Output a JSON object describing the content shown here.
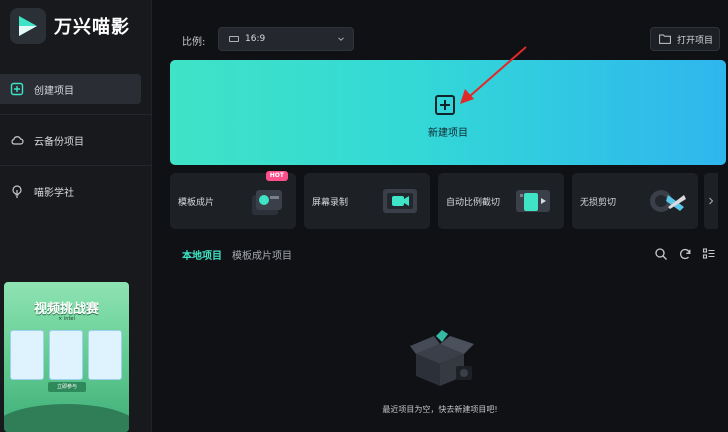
{
  "app": {
    "name": "万兴喵影"
  },
  "sidebar": {
    "items": [
      {
        "label": "创建项目",
        "icon": "add-square-icon",
        "active": true
      },
      {
        "label": "云备份项目",
        "icon": "cloud-icon",
        "active": false
      },
      {
        "label": "喵影学社",
        "icon": "bulb-icon",
        "active": false
      }
    ],
    "promo": {
      "title": "视频挑战赛",
      "subtitle": "× intel",
      "cta": "立即参与"
    }
  },
  "toolbar": {
    "ratio_label": "比例:",
    "ratio_value": "16:9",
    "open_label": "打开项目"
  },
  "hero": {
    "label": "新建项目"
  },
  "tools": [
    {
      "label": "模板成片",
      "badge": "HOT"
    },
    {
      "label": "屏幕录制"
    },
    {
      "label": "自动比例截切"
    },
    {
      "label": "无损剪切"
    }
  ],
  "tabs": [
    {
      "label": "本地项目",
      "active": true
    },
    {
      "label": "模板成片项目",
      "active": false
    }
  ],
  "empty": {
    "message": "最近项目为空，快去新建项目吧!"
  },
  "colors": {
    "accent": "#3fe3c6",
    "hero_start": "#3fe3c6",
    "hero_end": "#2fb6ee",
    "hot": "#ff4f8b"
  }
}
